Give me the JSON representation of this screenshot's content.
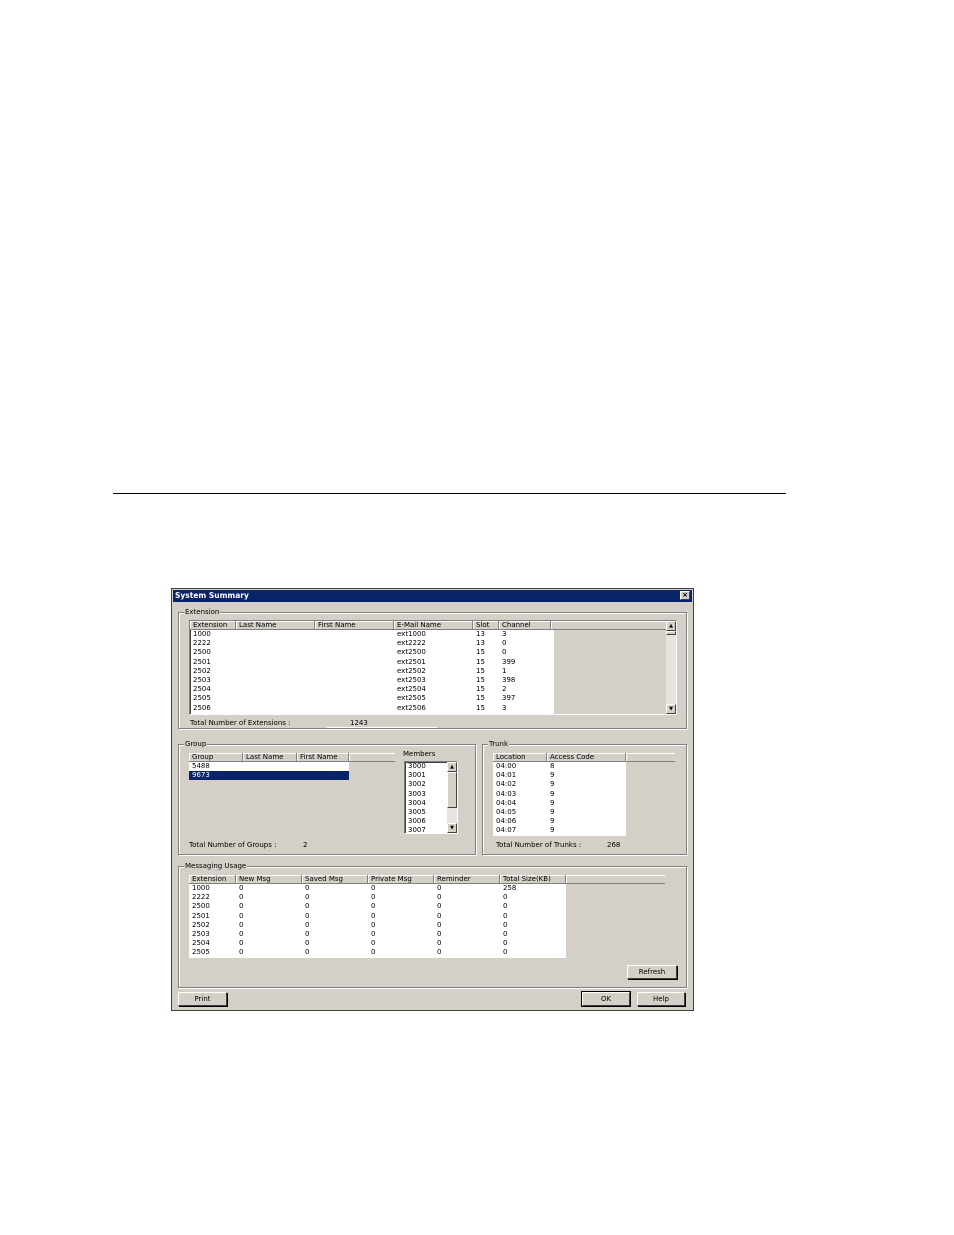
{
  "dialog": {
    "title": "System Summary",
    "close_label": "×"
  },
  "extension": {
    "legend": "Extension",
    "columns": [
      "Extension",
      "Last Name",
      "First Name",
      "E-Mail Name",
      "Slot",
      "Channel"
    ],
    "rows": [
      [
        "1000",
        "",
        "",
        "ext1000",
        "13",
        "3"
      ],
      [
        "2222",
        "",
        "",
        "ext2222",
        "13",
        "0"
      ],
      [
        "2500",
        "",
        "",
        "ext2500",
        "15",
        "0"
      ],
      [
        "2501",
        "",
        "",
        "ext2501",
        "15",
        "399"
      ],
      [
        "2502",
        "",
        "",
        "ext2502",
        "15",
        "1"
      ],
      [
        "2503",
        "",
        "",
        "ext2503",
        "15",
        "398"
      ],
      [
        "2504",
        "",
        "",
        "ext2504",
        "15",
        "2"
      ],
      [
        "2505",
        "",
        "",
        "ext2505",
        "15",
        "397"
      ],
      [
        "2506",
        "",
        "",
        "ext2506",
        "15",
        "3"
      ]
    ],
    "total_label": "Total Number of Extensions :",
    "total_value": "1243"
  },
  "group": {
    "legend": "Group",
    "columns": [
      "Group",
      "Last Name",
      "First Name"
    ],
    "rows": [
      [
        "5488",
        "",
        ""
      ],
      [
        "9673",
        "",
        ""
      ]
    ],
    "selected_index": 1,
    "members_label": "Members",
    "members": [
      "3000",
      "3001",
      "3002",
      "3003",
      "3004",
      "3005",
      "3006",
      "3007"
    ],
    "total_label": "Total Number of Groups :",
    "total_value": "2"
  },
  "trunk": {
    "legend": "Trunk",
    "columns": [
      "Location",
      "Access Code"
    ],
    "rows": [
      [
        "04:00",
        "8"
      ],
      [
        "04:01",
        "9"
      ],
      [
        "04:02",
        "9"
      ],
      [
        "04:03",
        "9"
      ],
      [
        "04:04",
        "9"
      ],
      [
        "04:05",
        "9"
      ],
      [
        "04:06",
        "9"
      ],
      [
        "04:07",
        "9"
      ]
    ],
    "total_label": "Total Number of Trunks :",
    "total_value": "268"
  },
  "messaging": {
    "legend": "Messaging Usage",
    "columns": [
      "Extension",
      "New Msg",
      "Saved Msg",
      "Private Msg",
      "Reminder",
      "Total Size(KB)"
    ],
    "rows": [
      [
        "1000",
        "0",
        "0",
        "0",
        "0",
        "258"
      ],
      [
        "2222",
        "0",
        "0",
        "0",
        "0",
        "0"
      ],
      [
        "2500",
        "0",
        "0",
        "0",
        "0",
        "0"
      ],
      [
        "2501",
        "0",
        "0",
        "0",
        "0",
        "0"
      ],
      [
        "2502",
        "0",
        "0",
        "0",
        "0",
        "0"
      ],
      [
        "2503",
        "0",
        "0",
        "0",
        "0",
        "0"
      ],
      [
        "2504",
        "0",
        "0",
        "0",
        "0",
        "0"
      ],
      [
        "2505",
        "0",
        "0",
        "0",
        "0",
        "0"
      ]
    ],
    "refresh_label": "Refresh"
  },
  "buttons": {
    "print": "Print",
    "ok": "OK",
    "help": "Help"
  }
}
